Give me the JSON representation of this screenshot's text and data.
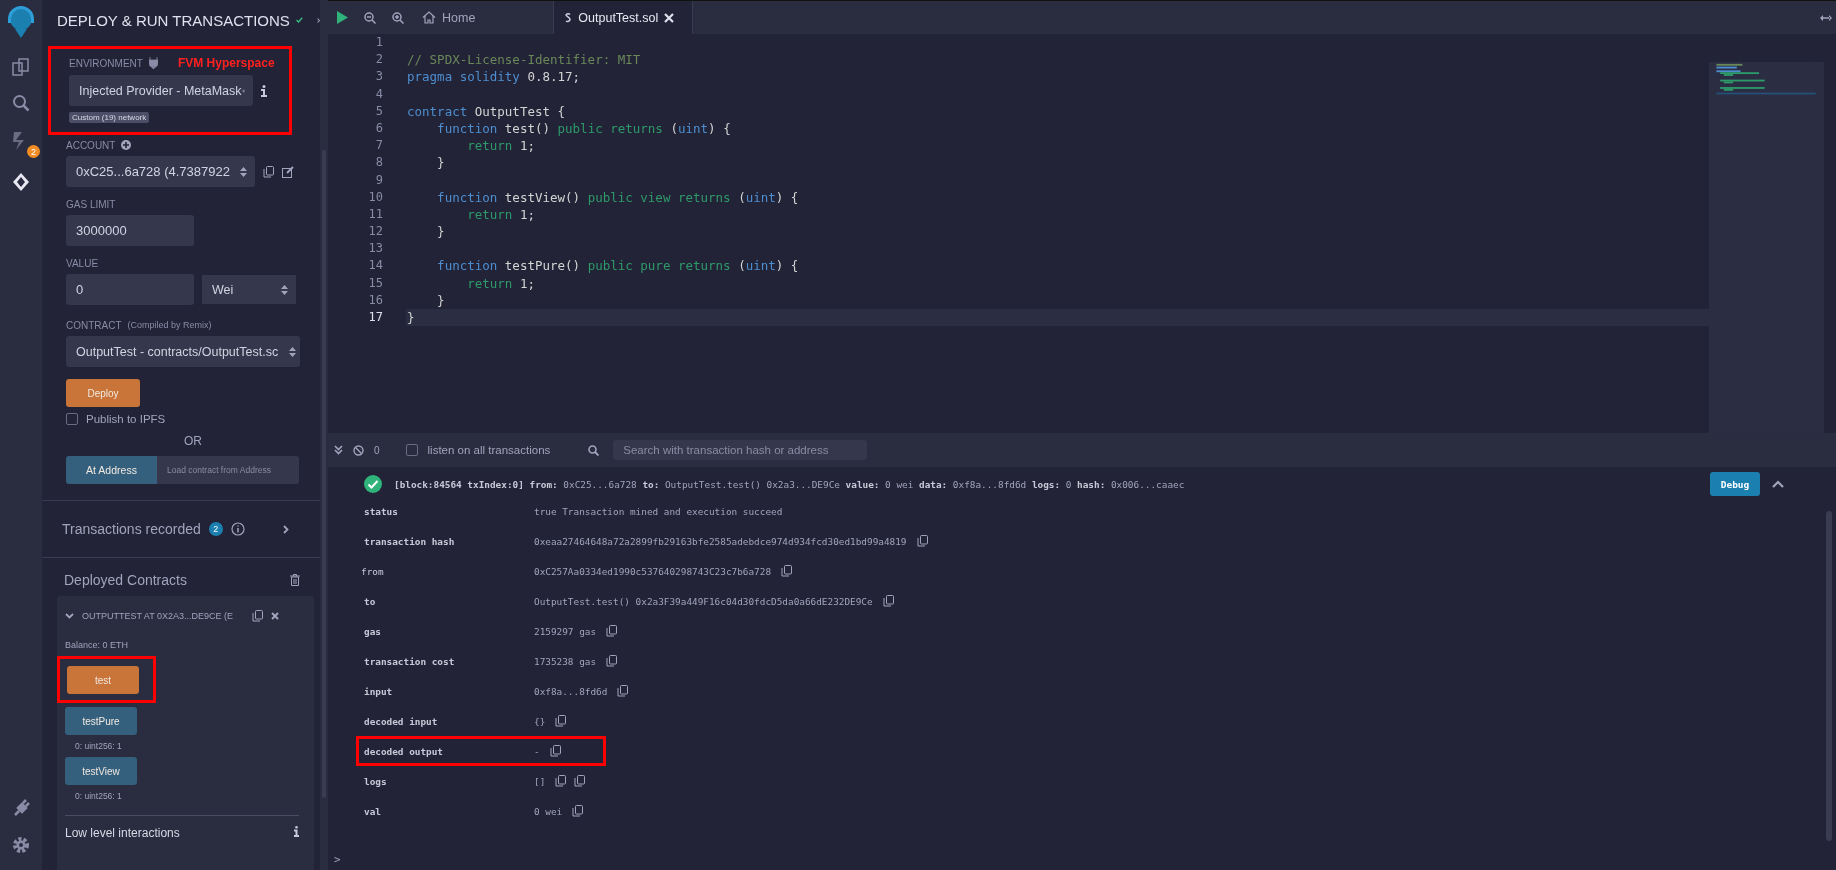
{
  "icon_bar": {
    "badge": "2"
  },
  "panel": {
    "title": "DEPLOY & RUN TRANSACTIONS",
    "environment": {
      "label": "ENVIRONMENT",
      "note": "FVM Hyperspace",
      "value": "Injected Provider - MetaMask",
      "network": "Custom (19) network",
      "highlighted": true
    },
    "account": {
      "label": "ACCOUNT",
      "value": "0xC25...6a728 (4.7387922"
    },
    "gas_limit": {
      "label": "GAS LIMIT",
      "value": "3000000"
    },
    "value": {
      "label": "VALUE",
      "value": "0",
      "unit": "Wei"
    },
    "contract": {
      "label": "CONTRACT",
      "hint": "(Compiled by Remix)",
      "value": "OutputTest - contracts/OutputTest.sc"
    },
    "deploy_button": "Deploy",
    "publish": {
      "label": "Publish to IPFS",
      "checked": false
    },
    "or": "OR",
    "at_address": {
      "button": "At Address",
      "placeholder": "Load contract from Address"
    },
    "transactions_recorded": {
      "label": "Transactions recorded",
      "count": "2"
    },
    "deployed": {
      "title": "Deployed Contracts",
      "instance": {
        "title": "OUTPUTTEST AT 0X2A3...DE9CE (E",
        "expanded": true,
        "balance": "Balance: 0 ETH",
        "functions": [
          {
            "name": "test",
            "kind": "transact",
            "highlighted": true
          },
          {
            "name": "testPure",
            "kind": "call",
            "highlighted": false,
            "output": "0: uint256: 1"
          },
          {
            "name": "testView",
            "kind": "call",
            "highlighted": false,
            "output": "0: uint256: 1"
          }
        ]
      },
      "low_level": "Low level interactions"
    }
  },
  "editor": {
    "tabs": [
      {
        "label": "Home",
        "kind": "home",
        "selected": false
      },
      {
        "label": "OutputTest.sol",
        "kind": "file",
        "selected": true
      }
    ],
    "lines": [
      {
        "number": "1",
        "active": false
      },
      {
        "number": "2",
        "active": false,
        "tokens": [
          {
            "text": "// SPDX-License-Identifier: MIT",
            "kind": "comment"
          }
        ]
      },
      {
        "number": "3",
        "active": false,
        "tokens": [
          {
            "text": "pragma",
            "kind": "keyword"
          },
          {
            "text": " solidity",
            "kind": "keyword"
          },
          {
            "text": " 0.8.17;",
            "kind": "plain"
          }
        ]
      },
      {
        "number": "4",
        "active": false
      },
      {
        "number": "5",
        "active": false,
        "tokens": [
          {
            "text": "contract",
            "kind": "keyword"
          },
          {
            "text": " OutputTest {",
            "kind": "plain"
          }
        ]
      },
      {
        "number": "6",
        "active": false,
        "tokens": [
          {
            "text": "    function",
            "kind": "keyword"
          },
          {
            "text": " test() ",
            "kind": "plain"
          },
          {
            "text": "public",
            "kind": "modifier"
          },
          {
            "text": " returns",
            "kind": "modifier"
          },
          {
            "text": " (",
            "kind": "plain"
          },
          {
            "text": "uint",
            "kind": "keyword"
          },
          {
            "text": ") {",
            "kind": "plain"
          }
        ]
      },
      {
        "number": "7",
        "active": false,
        "tokens": [
          {
            "text": "        return",
            "kind": "modifier"
          },
          {
            "text": " 1;",
            "kind": "plain"
          }
        ]
      },
      {
        "number": "8",
        "active": false,
        "tokens": [
          {
            "text": "    }",
            "kind": "plain"
          }
        ]
      },
      {
        "number": "9",
        "active": false
      },
      {
        "number": "10",
        "active": false,
        "tokens": [
          {
            "text": "    function",
            "kind": "keyword"
          },
          {
            "text": " testView() ",
            "kind": "plain"
          },
          {
            "text": "public",
            "kind": "modifier"
          },
          {
            "text": " view",
            "kind": "modifier"
          },
          {
            "text": " returns",
            "kind": "modifier"
          },
          {
            "text": " (",
            "kind": "plain"
          },
          {
            "text": "uint",
            "kind": "keyword"
          },
          {
            "text": ") {",
            "kind": "plain"
          }
        ]
      },
      {
        "number": "11",
        "active": false,
        "tokens": [
          {
            "text": "        return",
            "kind": "modifier"
          },
          {
            "text": " 1;",
            "kind": "plain"
          }
        ]
      },
      {
        "number": "12",
        "active": false,
        "tokens": [
          {
            "text": "    }",
            "kind": "plain"
          }
        ]
      },
      {
        "number": "13",
        "active": false
      },
      {
        "number": "14",
        "active": false,
        "tokens": [
          {
            "text": "    function",
            "kind": "keyword"
          },
          {
            "text": " testPure() ",
            "kind": "plain"
          },
          {
            "text": "public",
            "kind": "modifier"
          },
          {
            "text": " pure",
            "kind": "modifier"
          },
          {
            "text": " returns",
            "kind": "modifier"
          },
          {
            "text": " (",
            "kind": "plain"
          },
          {
            "text": "uint",
            "kind": "keyword"
          },
          {
            "text": ") {",
            "kind": "plain"
          }
        ]
      },
      {
        "number": "15",
        "active": false,
        "tokens": [
          {
            "text": "        return",
            "kind": "modifier"
          },
          {
            "text": " 1;",
            "kind": "plain"
          }
        ]
      },
      {
        "number": "16",
        "active": false,
        "tokens": [
          {
            "text": "    }",
            "kind": "plain"
          }
        ]
      },
      {
        "number": "17",
        "active": true,
        "tokens": [
          {
            "text": "}",
            "kind": "plain"
          }
        ]
      }
    ]
  },
  "terminal": {
    "pending": "0",
    "listen": {
      "label": "listen on all transactions",
      "checked": false
    },
    "search_placeholder": "Search with transaction hash or address",
    "transaction": {
      "summary": "**[block:84564 txIndex:0]**  **from:** 0xC25...6a728 **to:** OutputTest.test() 0x2a3...DE9Ce **value:** 0 wei **data:** 0xf8a...8fd6d **logs:** 0 **hash:** 0x006...caaec",
      "debug": "Debug",
      "expanded": true,
      "details": [
        {
          "key": "status",
          "bold": true,
          "value": "true Transaction mined and execution succeed",
          "highlighted": false
        },
        {
          "key": "transaction hash",
          "bold": true,
          "value": "0xeaa27464648a72a2899fb29163bfe2585adebdce974d934fcd30ed1bd99a4819",
          "icons": [
            {
              "kind": "copy"
            }
          ],
          "highlighted": false
        },
        {
          "key": "from",
          "bold": false,
          "value": "0xC257Aa0334ed1990c537640298743C23c7b6a728",
          "icons": [
            {
              "kind": "copy"
            }
          ],
          "highlighted": false
        },
        {
          "key": "to",
          "bold": true,
          "value": "OutputTest.test() 0x2a3F39a449F16c04d30fdcD5da0a66dE232DE9Ce",
          "icons": [
            {
              "kind": "copy"
            }
          ],
          "highlighted": false
        },
        {
          "key": "gas",
          "bold": true,
          "value": "2159297 gas",
          "icons": [
            {
              "kind": "copy"
            }
          ],
          "highlighted": false
        },
        {
          "key": "transaction cost",
          "bold": true,
          "value": "1735238 gas",
          "icons": [
            {
              "kind": "copy"
            }
          ],
          "highlighted": false
        },
        {
          "key": "input",
          "bold": true,
          "value": "0xf8a...8fd6d",
          "icons": [
            {
              "kind": "copy"
            }
          ],
          "highlighted": false
        },
        {
          "key": "decoded input",
          "bold": true,
          "value": "{}",
          "icons": [
            {
              "kind": "copy"
            }
          ],
          "highlighted": false
        },
        {
          "key": "decoded output",
          "bold": true,
          "value": "-",
          "icons": [
            {
              "kind": "copy"
            }
          ],
          "highlighted": true
        },
        {
          "key": "logs",
          "bold": true,
          "value": "[]",
          "icons": [
            {
              "kind": "copy"
            },
            {
              "kind": "copy"
            }
          ],
          "highlighted": false
        },
        {
          "key": "val",
          "bold": true,
          "value": "0 wei",
          "icons": [
            {
              "kind": "copy"
            }
          ],
          "highlighted": false
        }
      ]
    },
    "prompt": ">"
  }
}
